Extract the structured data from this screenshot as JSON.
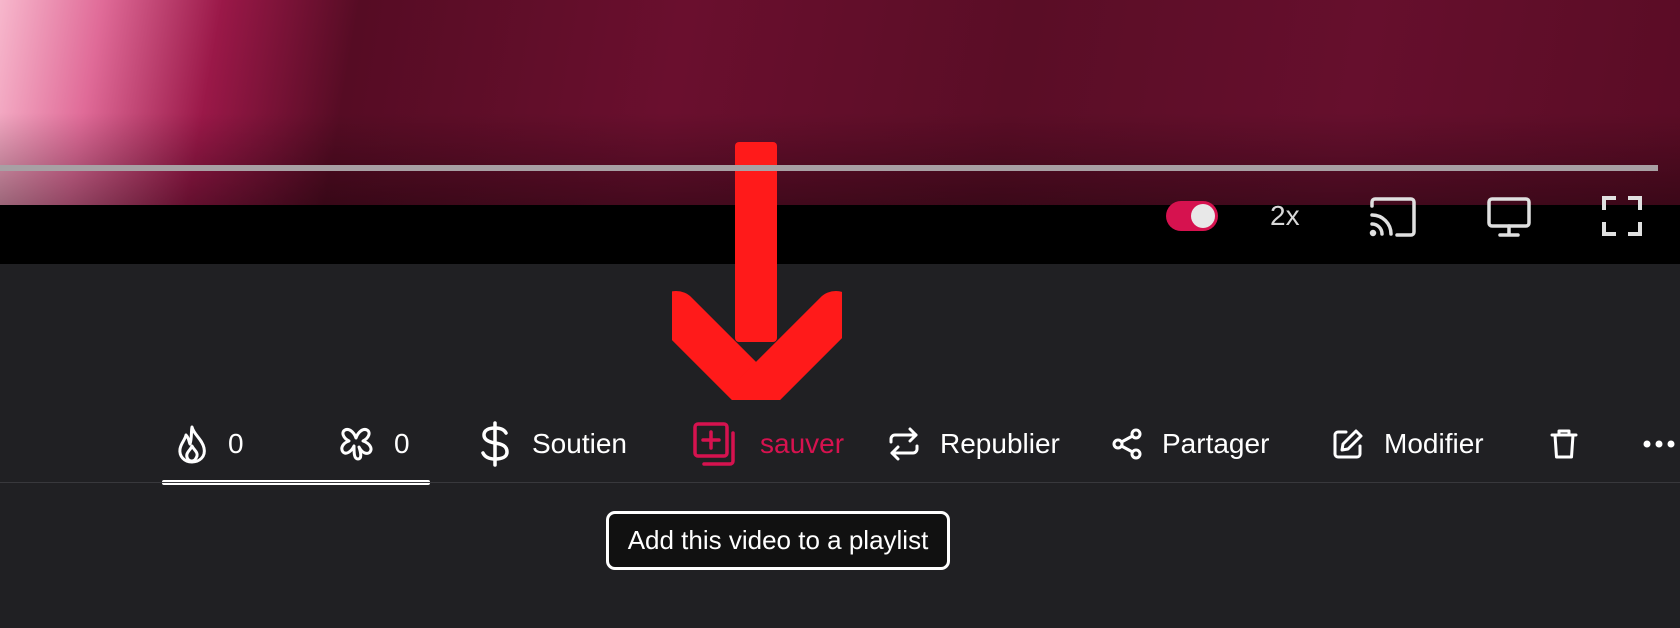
{
  "player": {
    "speed": "2x",
    "autoplay_on": true,
    "icons": [
      "cast-icon",
      "screen-icon",
      "fullscreen-icon"
    ],
    "accent_color": "#d6124f"
  },
  "actions": {
    "reactions": {
      "icon": "flame-icon",
      "count": "0"
    },
    "boosts": {
      "icon": "asterisk-icon",
      "count": "0"
    },
    "support": {
      "icon": "dollar-icon",
      "label": "Soutien"
    },
    "save": {
      "icon": "playlist-add-icon",
      "label": "sauver",
      "color": "#d6124f"
    },
    "republish": {
      "icon": "repost-icon",
      "label": "Republier"
    },
    "share": {
      "icon": "share-icon",
      "label": "Partager"
    },
    "edit": {
      "icon": "edit-icon",
      "label": "Modifier"
    },
    "delete": {
      "icon": "trash-icon"
    },
    "more": {
      "icon": "more-icon"
    }
  },
  "tooltip": {
    "text": "Add this video to a playlist"
  },
  "annotation": {
    "icon": "down-arrow-annotation",
    "color": "#ff1a1a"
  }
}
